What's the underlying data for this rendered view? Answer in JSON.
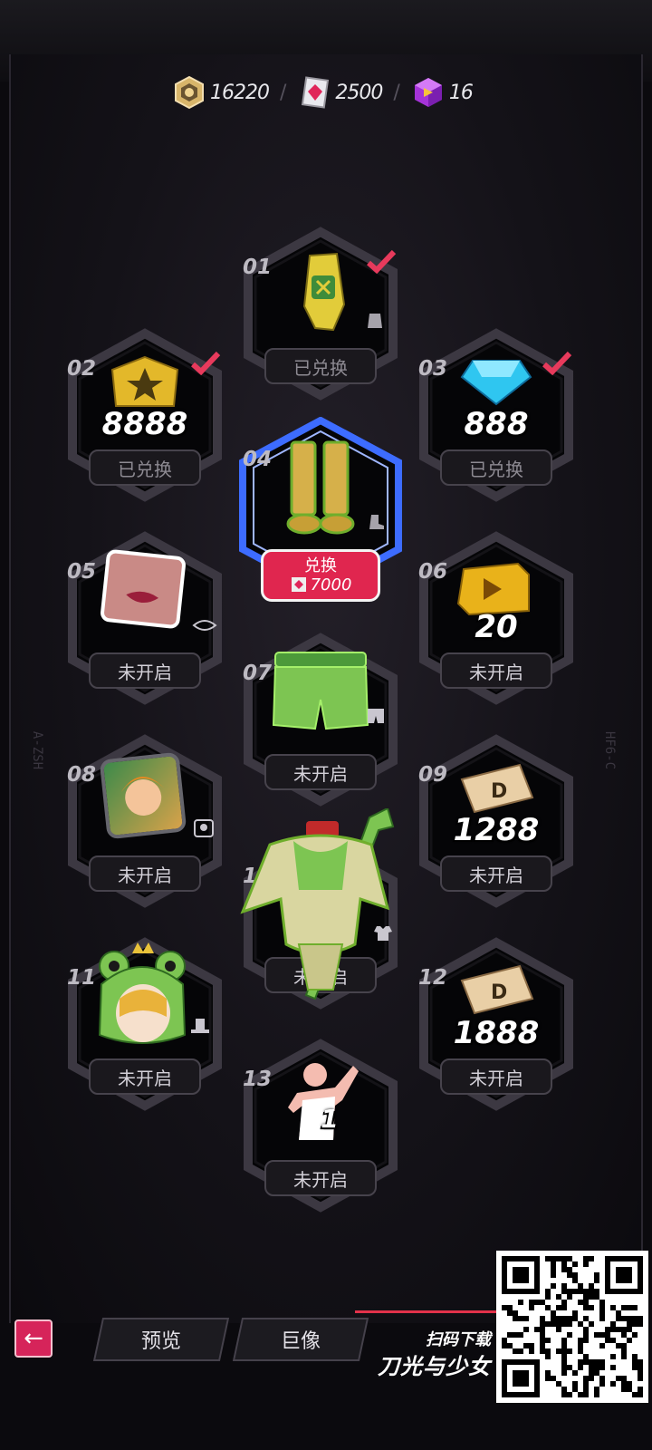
{
  "currencies": [
    {
      "icon": "gold-coin-icon",
      "value": "16220"
    },
    {
      "icon": "pink-diamond-icon",
      "value": "2500"
    },
    {
      "icon": "purple-cube-icon",
      "value": "16"
    }
  ],
  "slots": [
    {
      "num": "01",
      "item": "glove",
      "status": "已兑换",
      "redeemed": true
    },
    {
      "num": "02",
      "item": "gold-coin",
      "count": "8888",
      "status": "已兑换",
      "redeemed": true
    },
    {
      "num": "03",
      "item": "blue-gem",
      "count": "888",
      "status": "已兑换",
      "redeemed": true
    },
    {
      "num": "04",
      "item": "boots",
      "redeem_label": "兑换",
      "cost": "7000"
    },
    {
      "num": "05",
      "item": "lips-makeup",
      "status": "未开启"
    },
    {
      "num": "06",
      "item": "video-cube",
      "count": "20",
      "status": "未开启"
    },
    {
      "num": "07",
      "item": "shorts",
      "status": "未开启"
    },
    {
      "num": "08",
      "item": "avatar-frame",
      "status": "未开启"
    },
    {
      "num": "09",
      "item": "ticket",
      "count": "1288",
      "status": "未开启"
    },
    {
      "num": "10",
      "item": "costume",
      "status": "未开启"
    },
    {
      "num": "11",
      "item": "frog-hat",
      "status": "未开启"
    },
    {
      "num": "12",
      "item": "ticket",
      "count": "1888",
      "status": "未开启"
    },
    {
      "num": "13",
      "item": "pose",
      "count": "1",
      "status": "未开启"
    }
  ],
  "side_tags": {
    "left": "A-ZSH",
    "right": "HF6-C"
  },
  "bottom": {
    "tab_preview": "预览",
    "tab_statue": "巨像",
    "scan_label": "扫码下载",
    "brand_title": "刀光与少女"
  },
  "colors": {
    "accent": "#e0264f",
    "check": "#e83a5c",
    "hex_border": "#3c3842",
    "selected_glow": "#3d6cff"
  }
}
